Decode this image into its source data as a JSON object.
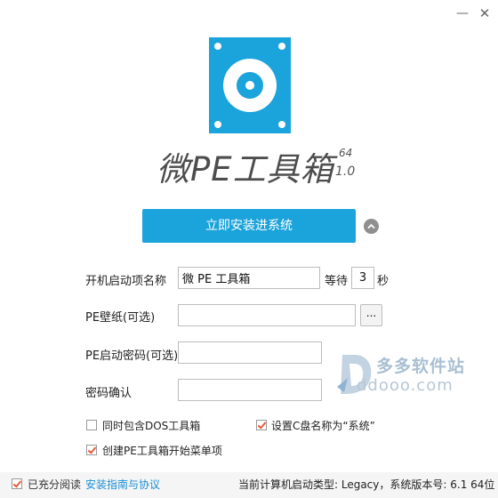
{
  "window": {
    "minimize_icon": "minimize-icon",
    "close_icon": "close-icon"
  },
  "app": {
    "logo_icon": "drive-disk-icon",
    "title": "微PE工具箱",
    "arch": "64",
    "version": "1.0"
  },
  "actions": {
    "install_label": "立即安装进系统",
    "expand_icon": "chevron-up-icon"
  },
  "form": {
    "boot_label": "开机启动项名称",
    "boot_value": "微 PE 工具箱",
    "wait_label": "等待",
    "wait_value": "3",
    "sec_label": "秒",
    "wallpaper_label": "PE壁纸(可选)",
    "wallpaper_value": "",
    "browse_label": "...",
    "password_label": "PE启动密码(可选)",
    "password_value": "",
    "confirm_label": "密码确认",
    "confirm_value": ""
  },
  "options": {
    "include_dos_label": "同时包含DOS工具箱",
    "include_dos_checked": false,
    "set_cname_label": "设置C盘名称为“系统”",
    "set_cname_checked": true,
    "create_menu_label": "创建PE工具箱开始菜单项",
    "create_menu_checked": true
  },
  "footer": {
    "agree_checked": true,
    "agree_label": "已充分阅读",
    "agree_link": "安装指南与协议",
    "status": "当前计算机启动类型: Legacy，系统版本号: 6.1 64位"
  },
  "watermark": {
    "name": "多多软件站",
    "url": "ddooo.com"
  },
  "colors": {
    "accent": "#1ba3db",
    "check": "#e55a3a",
    "link": "#1a8fd6"
  }
}
